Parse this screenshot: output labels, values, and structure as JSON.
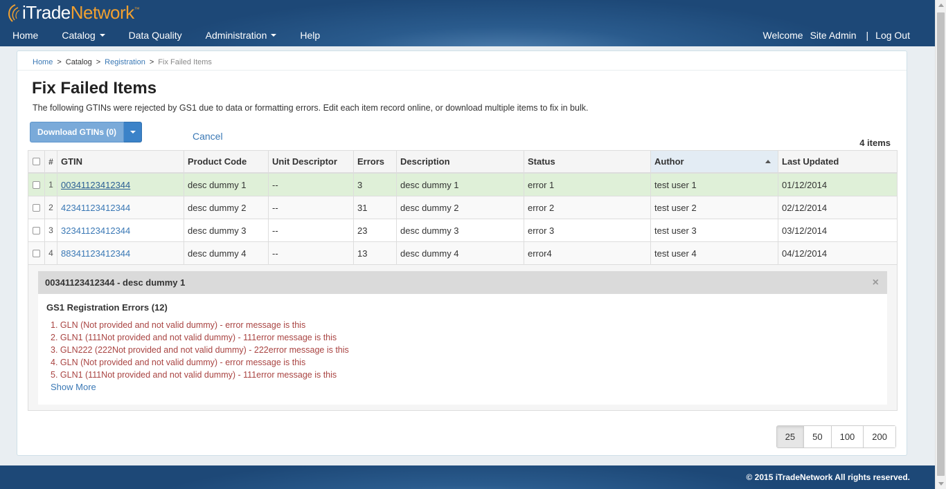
{
  "header": {
    "logo": {
      "i": "i",
      "trade": "Trade",
      "network": "Network",
      "tm": "™"
    },
    "nav": [
      {
        "label": "Home",
        "dropdown": false
      },
      {
        "label": "Catalog",
        "dropdown": true
      },
      {
        "label": "Data Quality",
        "dropdown": false
      },
      {
        "label": "Administration",
        "dropdown": true
      },
      {
        "label": "Help",
        "dropdown": false
      }
    ],
    "welcome": "Welcome",
    "user": "Site Admin",
    "separator": "|",
    "logout": "Log Out"
  },
  "breadcrumb": {
    "home": "Home",
    "catalog": "Catalog",
    "registration": "Registration",
    "current": "Fix Failed Items",
    "sep": ">"
  },
  "page": {
    "title": "Fix Failed Items",
    "subtitle": "The following GTINs were rejected by GS1 due to data or formatting errors. Edit each item record online, or download multiple items to fix in bulk.",
    "download_label": "Download GTINs (0)",
    "cancel_label": "Cancel",
    "item_count": "4 items"
  },
  "table": {
    "headers": {
      "num": "#",
      "gtin": "GTIN",
      "product_code": "Product Code",
      "unit_descriptor": "Unit Descriptor",
      "errors": "Errors",
      "description": "Description",
      "status": "Status",
      "author": "Author",
      "last_updated": "Last Updated"
    },
    "sort_column": "Author",
    "sort_direction": "ascending",
    "rows": [
      {
        "num": "1",
        "gtin": "00341123412344",
        "product_code": "desc dummy 1",
        "unit_descriptor": "--",
        "errors": "3",
        "description": "desc dummy 1",
        "status": "error 1",
        "author": "test user 1",
        "last_updated": "01/12/2014"
      },
      {
        "num": "2",
        "gtin": "42341123412344",
        "product_code": "desc dummy 2",
        "unit_descriptor": "--",
        "errors": "31",
        "description": "desc dummy 2",
        "status": "error 2",
        "author": "test user 2",
        "last_updated": "02/12/2014"
      },
      {
        "num": "3",
        "gtin": "32341123412344",
        "product_code": "desc dummy 3",
        "unit_descriptor": "--",
        "errors": "23",
        "description": "desc dummy 3",
        "status": "error 3",
        "author": "test user 3",
        "last_updated": "03/12/2014"
      },
      {
        "num": "4",
        "gtin": "88341123412344",
        "product_code": "desc dummy 4",
        "unit_descriptor": "--",
        "errors": "13",
        "description": "desc dummy 4",
        "status": "error4",
        "author": "test user 4",
        "last_updated": "04/12/2014"
      }
    ]
  },
  "detail": {
    "title": "00341123412344 - desc dummy 1",
    "close": "×",
    "errors_title": "GS1 Registration Errors (12)",
    "errors": [
      "1. GLN (Not provided and not valid dummy) - error message is this",
      "2. GLN1 (111Not provided and not valid dummy) - 111error message is this",
      "3. GLN222 (222Not provided and not valid dummy) - 222error message is this",
      "4. GLN (Not provided and not valid dummy) - error message is this",
      "5. GLN1 (111Not provided and not valid dummy) - 111error message is this"
    ],
    "show_more": "Show More"
  },
  "pagination": {
    "sizes": [
      "25",
      "50",
      "100",
      "200"
    ],
    "active": "25"
  },
  "footer": {
    "copyright": "© 2015 iTradeNetwork All rights reserved."
  },
  "colors": {
    "header_bg": "#2a5b8d",
    "accent_orange": "#f0a030",
    "link": "#3a78b5",
    "error_text": "#a94442",
    "selected_row": "#dff0d8"
  }
}
